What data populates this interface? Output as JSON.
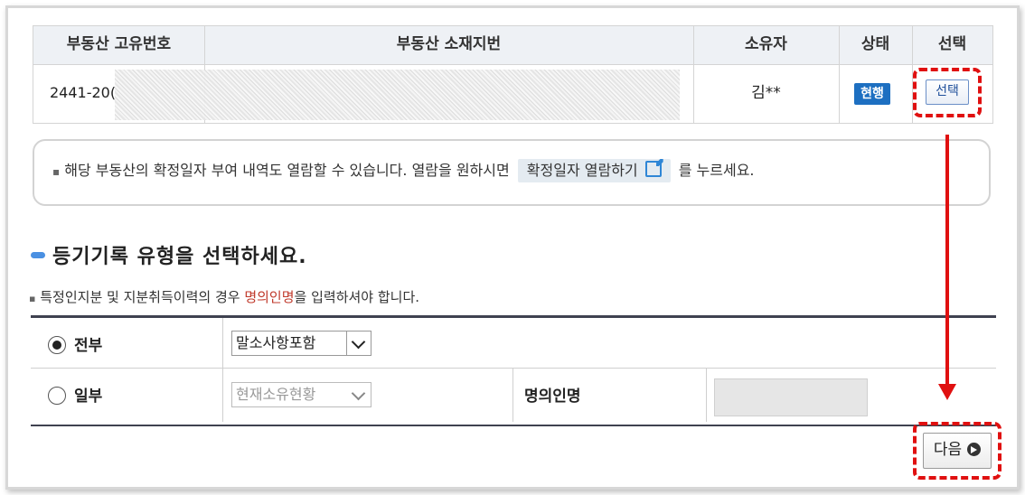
{
  "property_table": {
    "headers": [
      "부동산 고유번호",
      "부동산 소재지번",
      "소유자",
      "상태",
      "선택"
    ],
    "row": {
      "unique_no": "2441-20(",
      "address": "",
      "owner": "김**",
      "status": "현행",
      "select_label": "선택"
    }
  },
  "info": {
    "bullet": "▪",
    "text_before": "해당 부동산의 확정일자 부여 내역도 열람할 수 있습니다. 열람을 원하시면",
    "button_label": "확정일자 열람하기",
    "text_after": "를 누르세요."
  },
  "section": {
    "title": "등기기록 유형을 선택하세요.",
    "note_bullet": "▪",
    "note_before": "특정인지분 및 지분취득이력의 경우 ",
    "note_highlight": "명의인명",
    "note_after": "을 입력하셔야 합니다."
  },
  "options": {
    "all_label": "전부",
    "all_select_value": "말소사항포함",
    "partial_label": "일부",
    "partial_select_value": "현재소유현황",
    "name_label": "명의인명",
    "name_value": ""
  },
  "next_button": "다음",
  "colors": {
    "accent_blue": "#1d6fc1",
    "annotation_red": "#e01010",
    "highlight_red": "#c0392b"
  }
}
